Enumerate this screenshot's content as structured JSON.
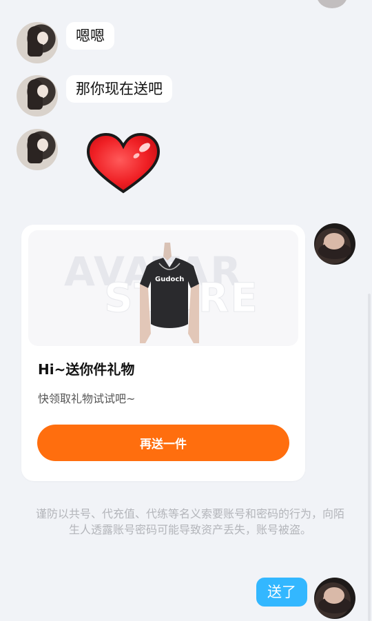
{
  "messages": {
    "m1": "嗯嗯",
    "m2": "那你现在送吧",
    "m4": "送了"
  },
  "gift_card": {
    "image_watermark_1": "AVATAR",
    "image_watermark_2": "STORE",
    "shirt_print": "Gudoch",
    "title": "Hi~送你件礼物",
    "subtitle": "快领取礼物试试吧~",
    "button_label": "再送一件"
  },
  "warning_text": "谨防以共号、代充值、代练等名义索要账号和密码的行为，向陌生人透露账号密码可能导致资产丢失，账号被盗。",
  "colors": {
    "background": "#f1f3f7",
    "accent_orange": "#ff6e0e",
    "sent_bubble_blue": "#33b7ff"
  },
  "icons": {
    "sticker": "heart-sticker-icon"
  }
}
